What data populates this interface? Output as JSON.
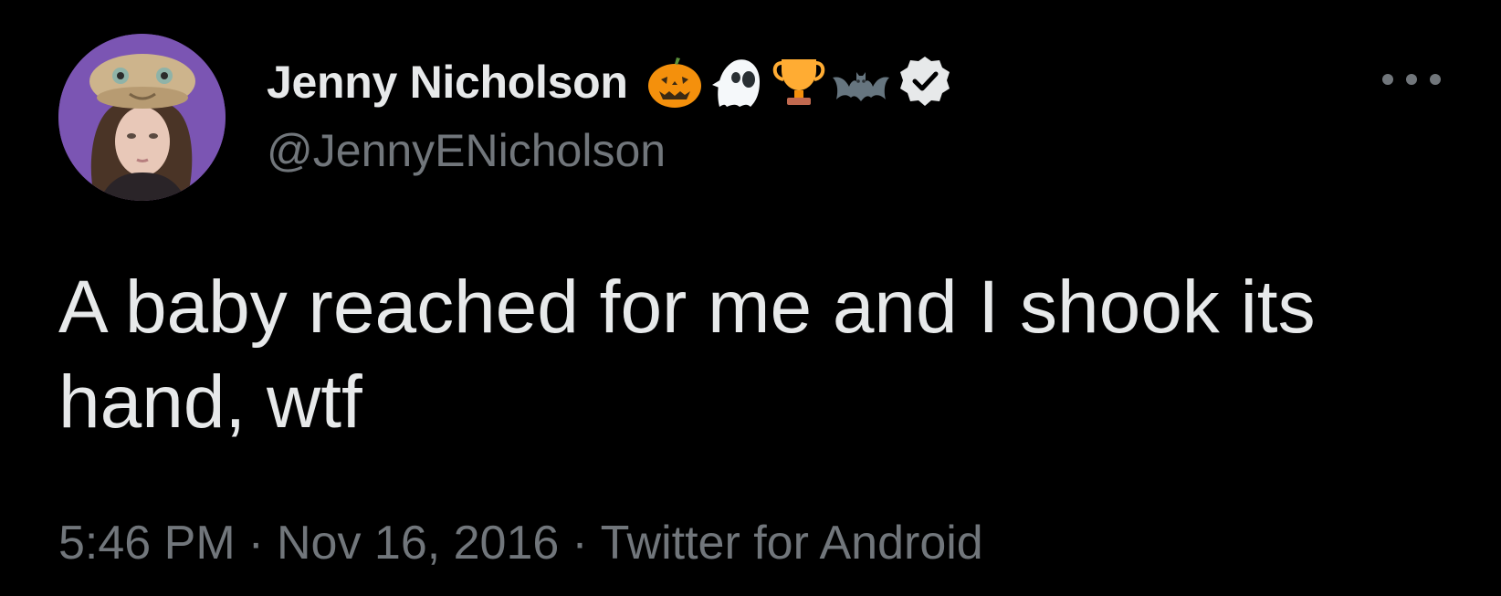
{
  "author": {
    "display_name": "Jenny Nicholson",
    "handle": "@JennyENicholson",
    "name_emojis": [
      "pumpkin-emoji",
      "ghost-emoji",
      "trophy-emoji",
      "bat-emoji"
    ],
    "verified_badge": "verified-icon"
  },
  "tweet": {
    "text": "A baby reached for me and I shook its hand, wtf",
    "time": "5:46 PM",
    "separator": "·",
    "date": "Nov 16, 2016",
    "source": "Twitter for Android"
  },
  "menu": {
    "more_icon": "more-options-icon"
  },
  "colors": {
    "background": "#000000",
    "primary_text": "#e7e9ea",
    "secondary_text": "#71767b",
    "avatar_background": "#7b55b3"
  }
}
